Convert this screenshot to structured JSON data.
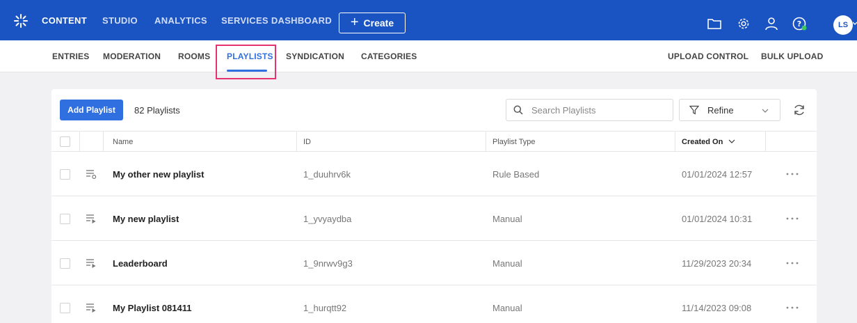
{
  "topbar": {
    "nav": [
      "CONTENT",
      "STUDIO",
      "ANALYTICS",
      "SERVICES DASHBOARD"
    ],
    "create_label": "Create",
    "avatar_initials": "LS",
    "bg_color": "#1a53c2"
  },
  "subnav": {
    "left": [
      "ENTRIES",
      "MODERATION",
      "ROOMS",
      "PLAYLISTS",
      "SYNDICATION",
      "CATEGORIES"
    ],
    "right": [
      "UPLOAD CONTROL",
      "BULK UPLOAD"
    ],
    "active": "PLAYLISTS"
  },
  "toolbar": {
    "add_label": "Add Playlist",
    "count_label": "82 Playlists",
    "search_placeholder": "Search Playlists",
    "refine_label": "Refine"
  },
  "table": {
    "headers": [
      "Name",
      "ID",
      "Playlist Type",
      "Created On"
    ],
    "rows": [
      {
        "name": "My other new playlist",
        "id": "1_duuhrv6k",
        "type": "Rule Based",
        "created": "01/01/2024 12:57",
        "icon": "rule-playlist-icon"
      },
      {
        "name": "My new playlist",
        "id": "1_yvyaydba",
        "type": "Manual",
        "created": "01/01/2024 10:31",
        "icon": "manual-playlist-icon"
      },
      {
        "name": "Leaderboard",
        "id": "1_9nrwv9g3",
        "type": "Manual",
        "created": "11/29/2023 20:34",
        "icon": "manual-playlist-icon"
      },
      {
        "name": "My Playlist 081411",
        "id": "1_hurqtt92",
        "type": "Manual",
        "created": "11/14/2023 09:08",
        "icon": "manual-playlist-icon"
      }
    ]
  }
}
